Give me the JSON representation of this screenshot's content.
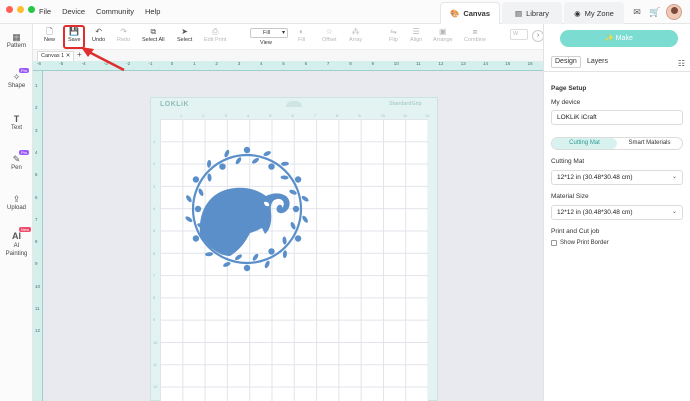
{
  "colors": {
    "accent": "#7bdcd1",
    "highlight": "#e02d2d",
    "design_blue": "#5b8fc9",
    "mat": "#e3f3f2"
  },
  "menu": [
    "File",
    "Device",
    "Community",
    "Help"
  ],
  "tabs": [
    {
      "label": "Canvas",
      "icon": "palette-icon"
    },
    {
      "label": "Library",
      "icon": "library-icon"
    },
    {
      "label": "My Zone",
      "icon": "user-zone-icon"
    }
  ],
  "toolbar": {
    "new": "New",
    "save": "Save",
    "undo": "Undo",
    "redo": "Redo",
    "select_all": "Select All",
    "select": "Select",
    "edit_print": "Edit Print",
    "fill_value": "Fill",
    "view": "View",
    "fill": "Fill",
    "offset": "Offset",
    "array": "Array",
    "flip": "Flip",
    "align": "Align",
    "arrange": "Arrange",
    "combine": "Combine",
    "w_label": "W"
  },
  "sidebar": [
    {
      "label": "Pattern",
      "icon": "pattern-icon",
      "badge": ""
    },
    {
      "label": "Shape",
      "icon": "shape-icon",
      "badge": "Pro"
    },
    {
      "label": "Text",
      "icon": "text-icon",
      "badge": ""
    },
    {
      "label": "Pen",
      "icon": "pen-icon",
      "badge": "Pro"
    },
    {
      "label": "Upload",
      "icon": "upload-icon",
      "badge": ""
    },
    {
      "label": "AI Painting",
      "icon": "ai-painting-icon",
      "badge": "New"
    }
  ],
  "canvas_tab": "Canvas 1",
  "ruler_top": [
    "-6",
    "-5",
    "-4",
    "-3",
    "-2",
    "-1",
    "0",
    "1",
    "2",
    "3",
    "4",
    "5",
    "6",
    "7",
    "8",
    "9",
    "10",
    "11",
    "12",
    "13",
    "14",
    "15",
    "16",
    "17"
  ],
  "ruler_left": [
    "1",
    "2",
    "3",
    "4",
    "5",
    "6",
    "7",
    "8",
    "9",
    "10",
    "11",
    "12"
  ],
  "mat": {
    "brand": "LOKLiK",
    "grip": "StandardGrip",
    "cols": [
      "1",
      "2",
      "3",
      "4",
      "5",
      "6",
      "7",
      "8",
      "9",
      "10",
      "11",
      "12"
    ],
    "rows": [
      "1",
      "2",
      "3",
      "4",
      "5",
      "6",
      "7",
      "8",
      "9",
      "10",
      "11",
      "12"
    ]
  },
  "panel": {
    "make": "Make",
    "tab_design": "Design",
    "tab_layers": "Layers",
    "page_setup": "Page Setup",
    "my_device": "My device",
    "device_value": "LOKLiK iCraft",
    "seg_cutting_mat": "Cutting Mat",
    "seg_smart": "Smart Materials",
    "cutting_mat_label": "Cutting Mat",
    "cutting_mat_value": "12*12 in (30.48*30.48 cm)",
    "material_size_label": "Material Size",
    "material_size_value": "12*12 in (30.48*30.48 cm)",
    "print_cut": "Print and Cut job",
    "show_border": "Show Print Border"
  }
}
